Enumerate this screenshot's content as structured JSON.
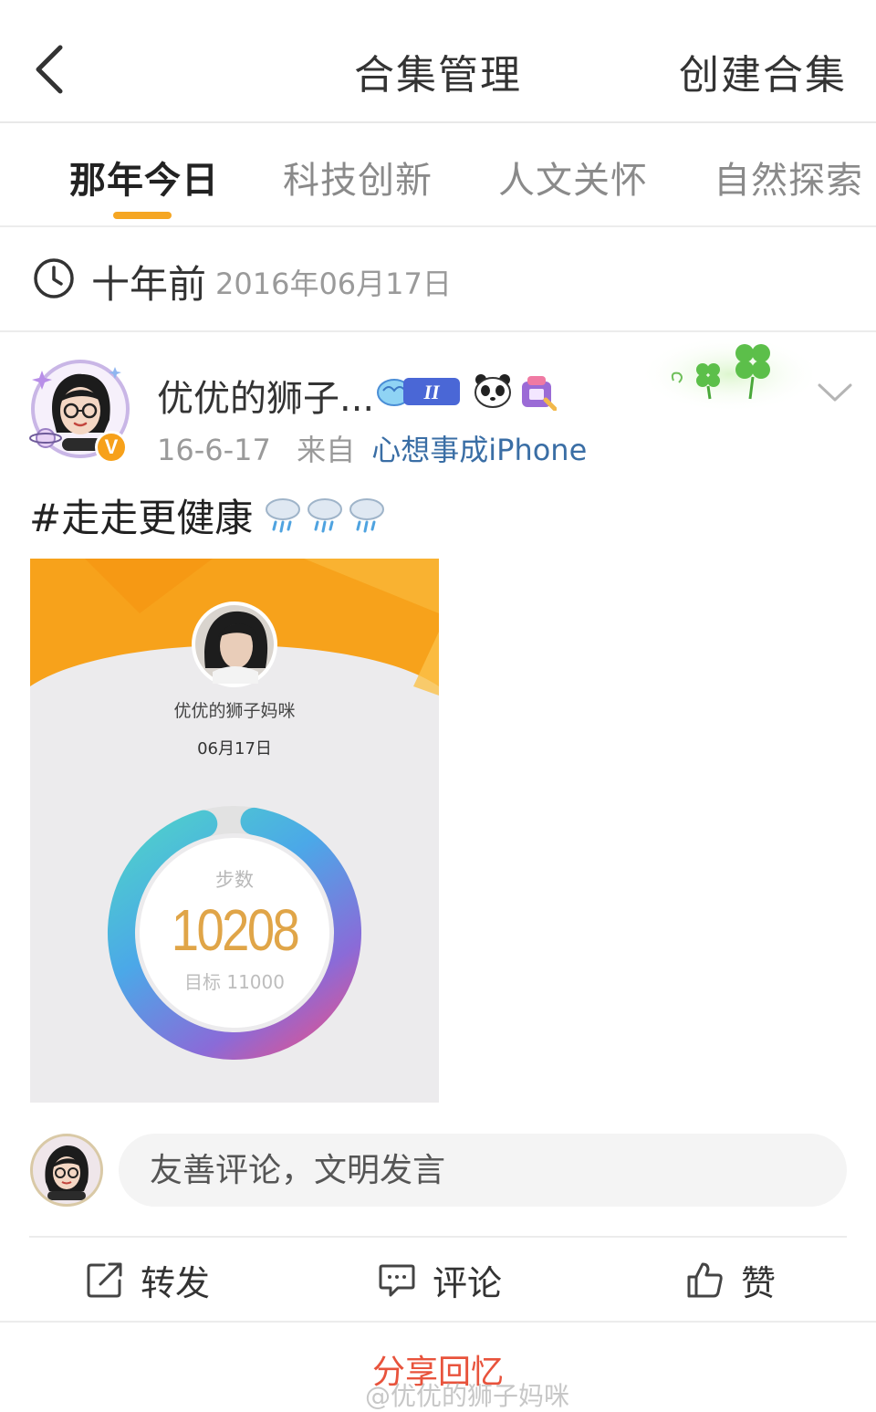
{
  "header": {
    "title": "合集管理",
    "create_label": "创建合集"
  },
  "tabs": [
    {
      "label": "那年今日",
      "active": true
    },
    {
      "label": "科技创新",
      "active": false
    },
    {
      "label": "人文关怀",
      "active": false
    },
    {
      "label": "自然探索",
      "active": false
    }
  ],
  "timebar": {
    "ago": "十年前",
    "date": "2016年06月17日"
  },
  "post": {
    "user_name": "优优的狮子...",
    "date": "16-6-17",
    "source_prefix": "来自",
    "source": "心想事成iPhone",
    "text": "#走走更健康",
    "badge_level": "II",
    "verified_mark": "V",
    "image": {
      "name": "优优的狮子妈咪",
      "date": "06月17日",
      "steps_label": "步数",
      "steps": "10208",
      "goal": "目标 11000",
      "progress_fraction": 0.928
    }
  },
  "comment": {
    "placeholder": "友善评论，文明发言"
  },
  "actions": {
    "repost": "转发",
    "comment": "评论",
    "like": "赞"
  },
  "footer": {
    "share": "分享回忆",
    "watermark": "@优优的狮子妈咪"
  },
  "colors": {
    "accent": "#f5a623",
    "link": "#3a6ea5",
    "share": "#e8533c",
    "steps": "#e0a548"
  }
}
